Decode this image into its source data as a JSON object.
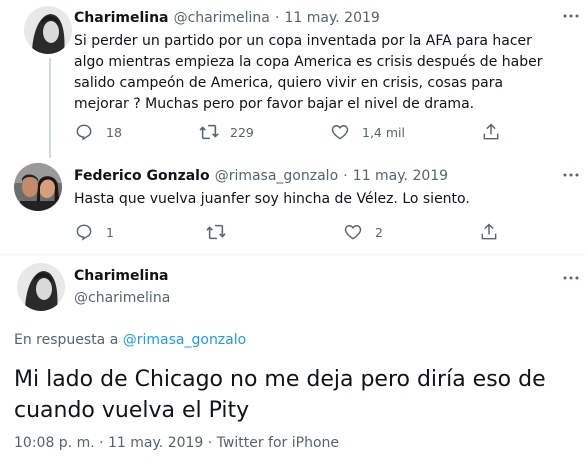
{
  "tweets": [
    {
      "name": "Charimelina",
      "handle": "@charimelina",
      "sep": "·",
      "date": "11 may. 2019",
      "text": "Si perder un partido por un copa inventada por la AFA para hacer algo mientras empieza la copa America es crisis después de haber salido campeón de America, quiero vivir en crisis, cosas para mejorar ? Muchas pero por favor bajar el nivel de drama.",
      "replies": "18",
      "retweets": "229",
      "likes": "1,4 mil"
    },
    {
      "name": "Federico Gonzalo",
      "handle": "@rimasa_gonzalo",
      "sep": "·",
      "date": "11 may. 2019",
      "text": "Hasta que vuelva juanfer soy hincha de Vélez. Lo siento.",
      "replies": "1",
      "retweets": "",
      "likes": "2"
    }
  ],
  "main": {
    "name": "Charimelina",
    "handle": "@charimelina",
    "reply_prefix": "En respuesta a ",
    "reply_to": "@rimasa_gonzalo",
    "text": "Mi lado de Chicago no me deja pero diría eso de cuando vuelva el Pity",
    "time": "10:08 p. m. · 11 may. 2019 · ",
    "source": "Twitter for iPhone"
  },
  "icons": [
    "avatar",
    "more-icon",
    "reply-icon",
    "retweet-icon",
    "like-icon",
    "share-icon"
  ],
  "colors": {
    "text": "#0f1419",
    "secondary": "#536471",
    "link": "#1d9bf0",
    "line": "#cfd9de"
  }
}
